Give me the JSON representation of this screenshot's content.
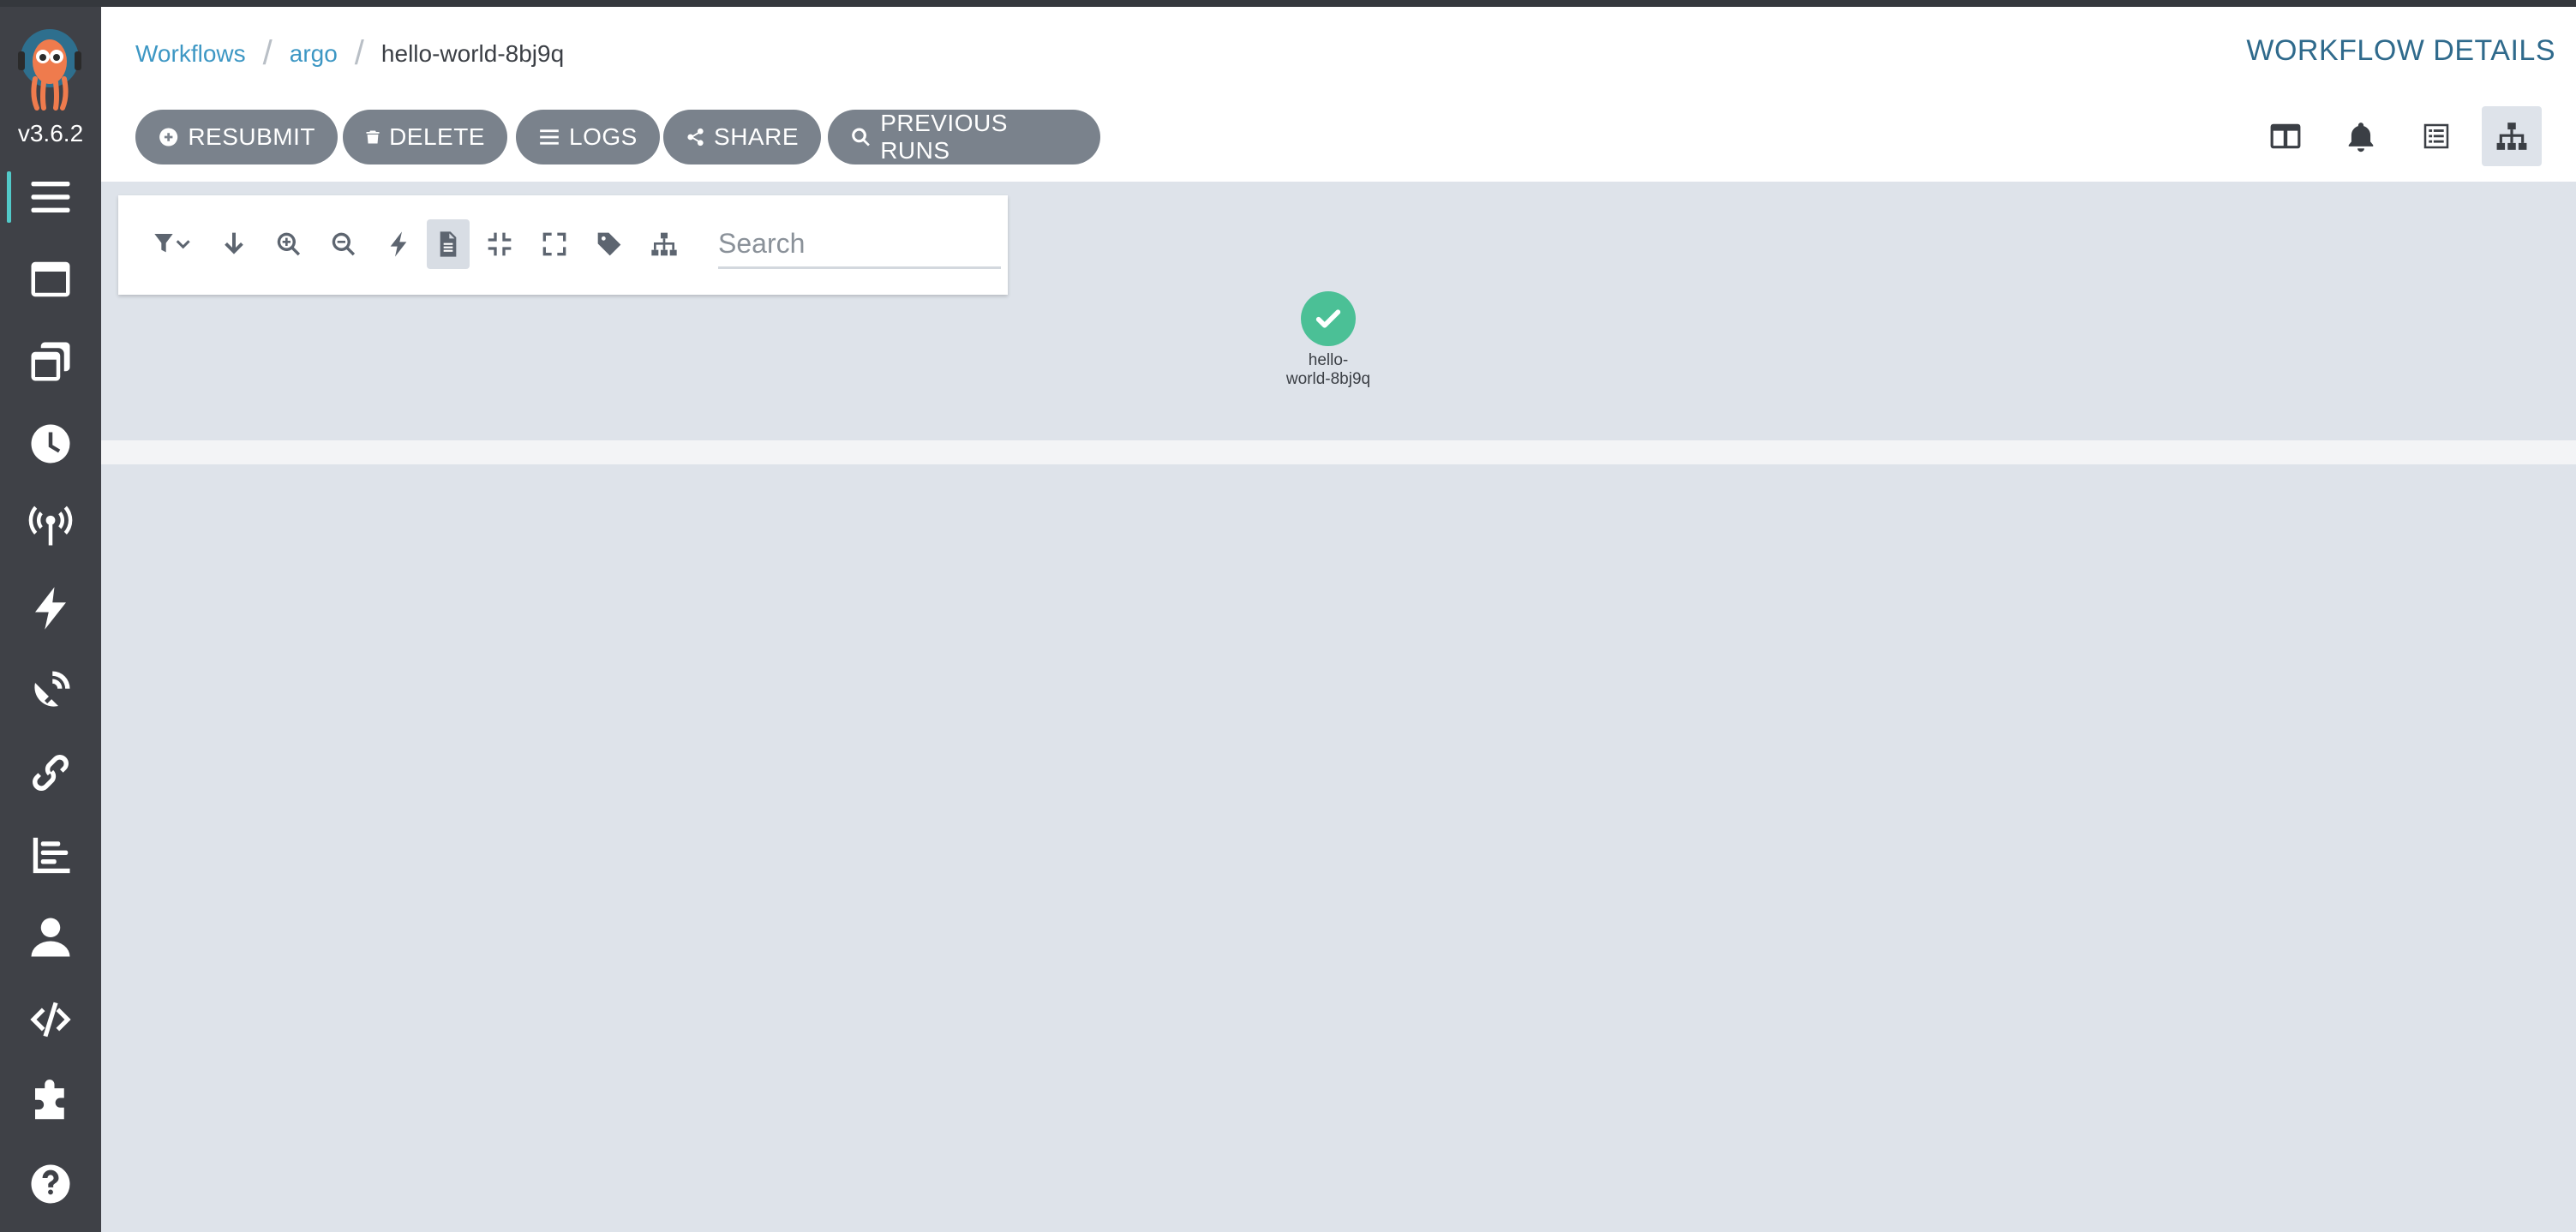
{
  "app": {
    "version": "v3.6.2"
  },
  "sidebar": {
    "items": [
      {
        "name": "workflows",
        "icon": "bars-icon",
        "active": true
      },
      {
        "name": "workflow-templates",
        "icon": "window-icon"
      },
      {
        "name": "cluster-workflow-templates",
        "icon": "clone-icon"
      },
      {
        "name": "cron-workflows",
        "icon": "clock-icon"
      },
      {
        "name": "event-sources",
        "icon": "broadcast-tower-icon"
      },
      {
        "name": "sensors",
        "icon": "bolt-icon"
      },
      {
        "name": "event-flow",
        "icon": "satellite-dish-icon"
      },
      {
        "name": "workflow-event-bindings",
        "icon": "link-icon"
      },
      {
        "name": "archived-workflows",
        "icon": "chart-bar-icon"
      },
      {
        "name": "user-info",
        "icon": "user-icon"
      },
      {
        "name": "api-docs",
        "icon": "code-icon"
      },
      {
        "name": "plugins",
        "icon": "puzzle-piece-icon"
      },
      {
        "name": "help",
        "icon": "question-circle-icon"
      }
    ]
  },
  "header": {
    "breadcrumbs": [
      "Workflows",
      "argo",
      "hello-world-8bj9q"
    ],
    "title": "WORKFLOW DETAILS"
  },
  "toolbar": {
    "resubmit": "RESUBMIT",
    "delete": "DELETE",
    "logs": "LOGS",
    "share": "SHARE",
    "previous_runs": "PREVIOUS RUNS"
  },
  "graph": {
    "search_placeholder": "Search",
    "node": {
      "label_line1": "hello-",
      "label_line2": "world-8bj9q",
      "status_color": "#4bc096"
    }
  },
  "colors": {
    "sidebar_bg": "#3f4147",
    "button_bg": "#7a828c",
    "link": "#3d97c4",
    "title": "#2f6a8c",
    "success": "#4bc096",
    "accent": "#52c9c9"
  }
}
